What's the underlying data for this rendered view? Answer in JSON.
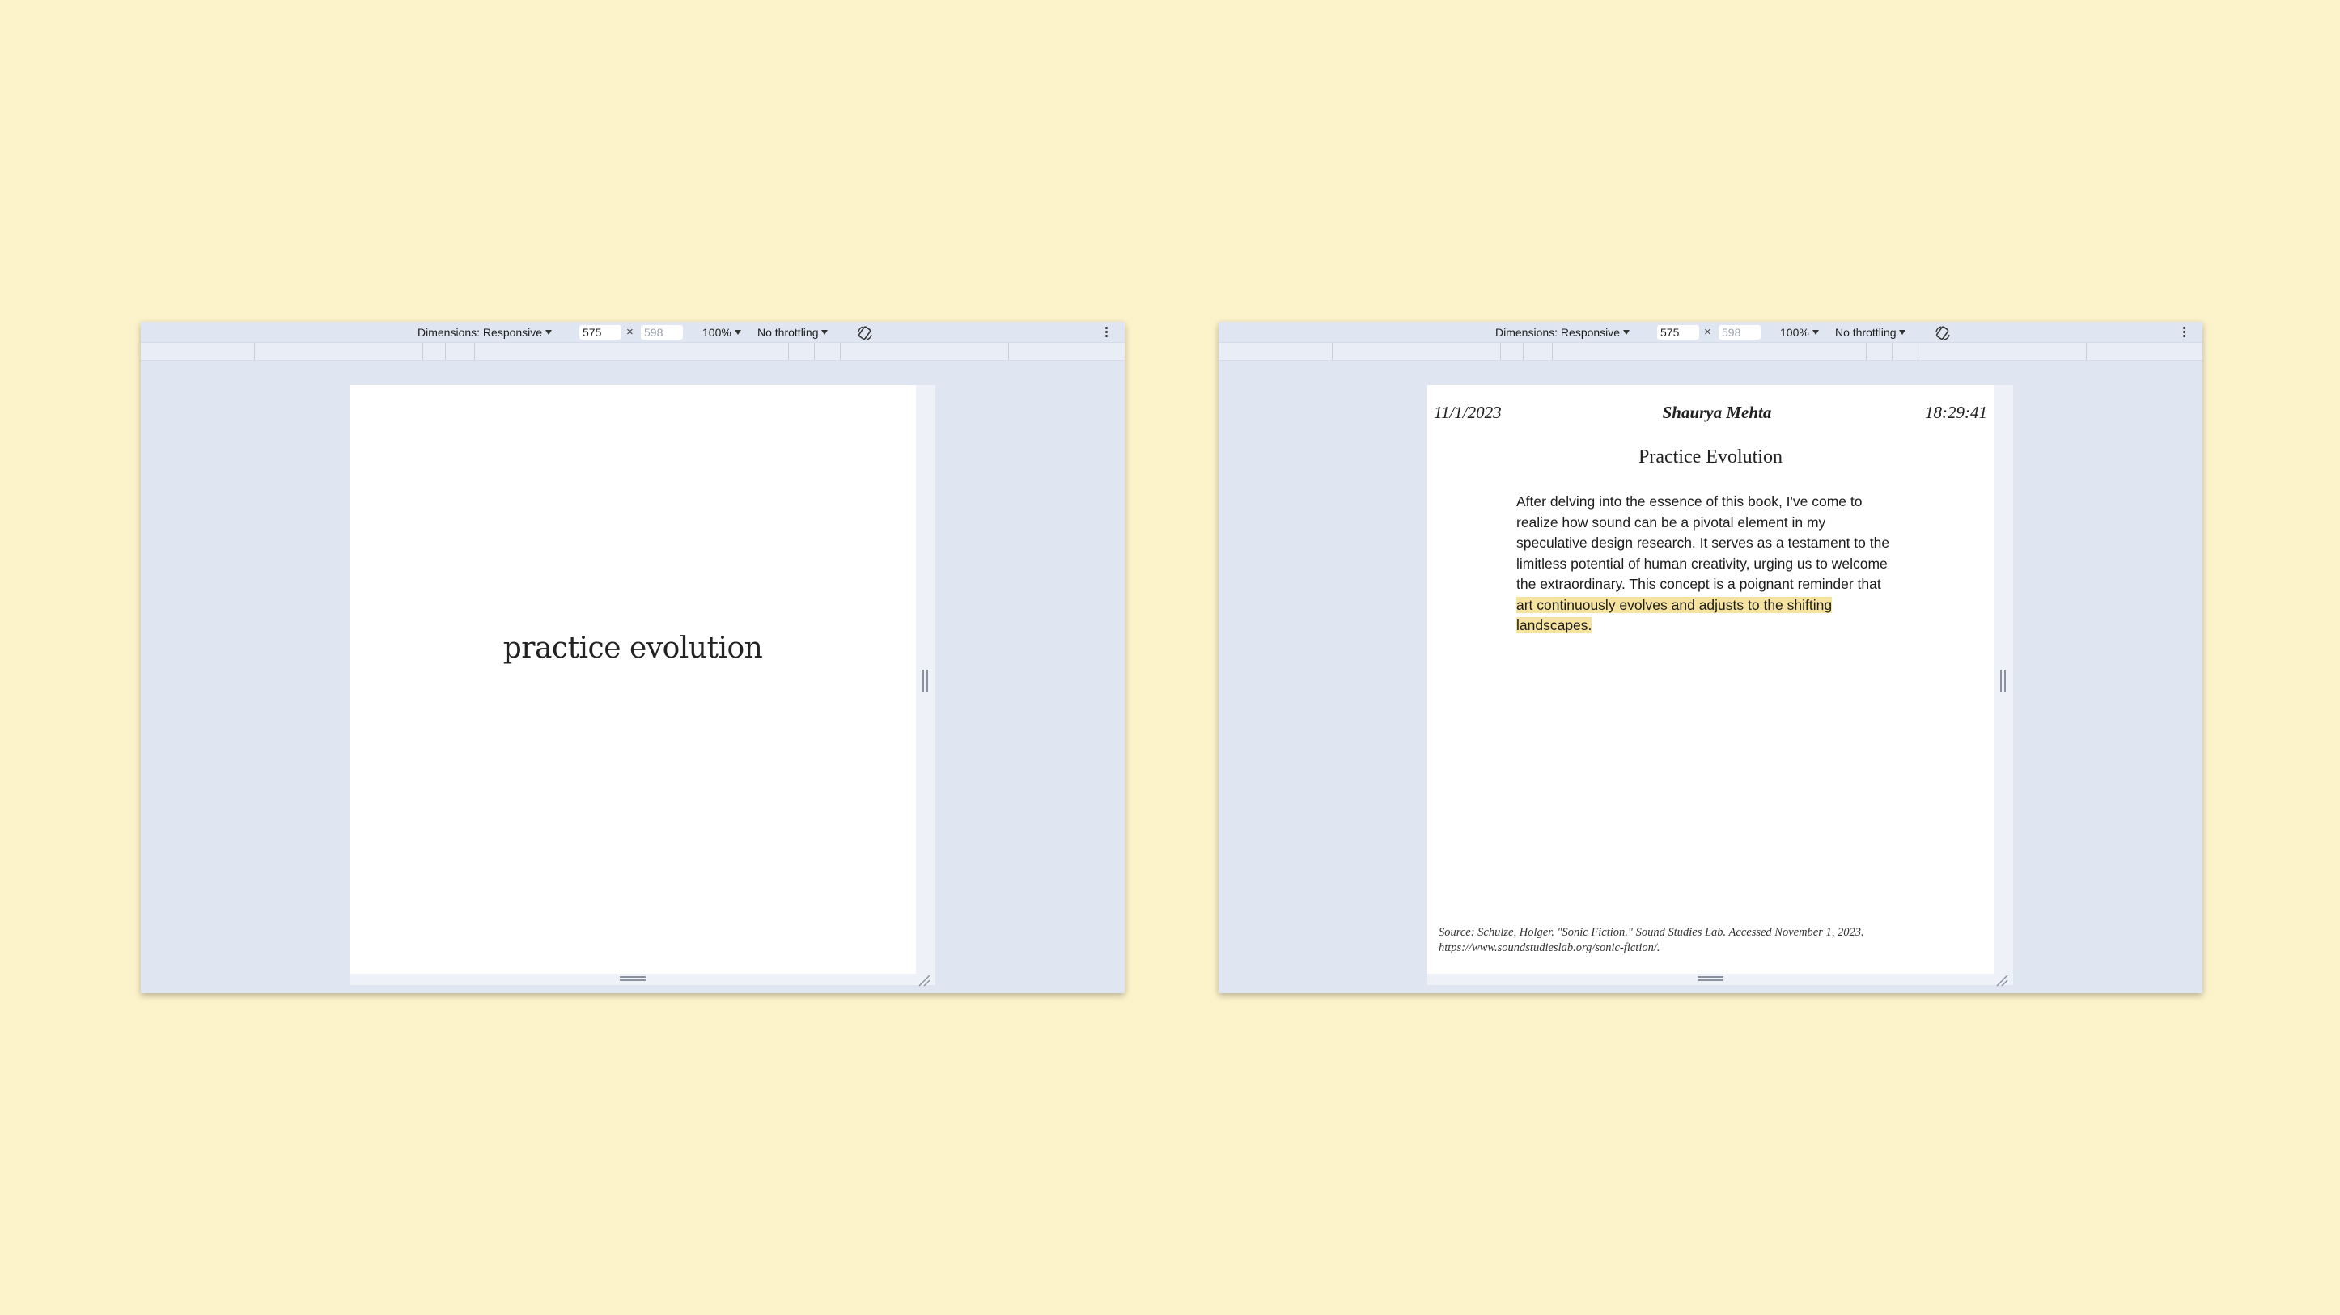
{
  "background_color": "#fcf3cb",
  "toolbar": {
    "dimensions_label": "Dimensions: Responsive",
    "width_value": "575",
    "height_placeholder": "598",
    "times_symbol": "×",
    "zoom": "100%",
    "throttling": "No throttling"
  },
  "left_page": {
    "cover_title": "practice evolution"
  },
  "right_page": {
    "date": "11/1/2023",
    "author": "Shaurya Mehta",
    "time": "18:29:41",
    "title": "Practice Evolution",
    "body_plain": "After delving into the essence of this book, I've come to realize how sound can be a pivotal element in my speculative design research. It serves as a testament to the limitless potential of human creativity, urging us to welcome the extraordinary. This concept is a poignant reminder that ",
    "body_highlight": "art continuously evolves and adjusts to the shifting landscapes.",
    "highlight_color": "#f7e3a0",
    "source_line1": "Source: Schulze, Holger. \"Sonic Fiction.\" Sound Studies Lab. Accessed November 1, 2023.",
    "source_line2": "https://www.soundstudieslab.org/sonic-fiction/."
  }
}
